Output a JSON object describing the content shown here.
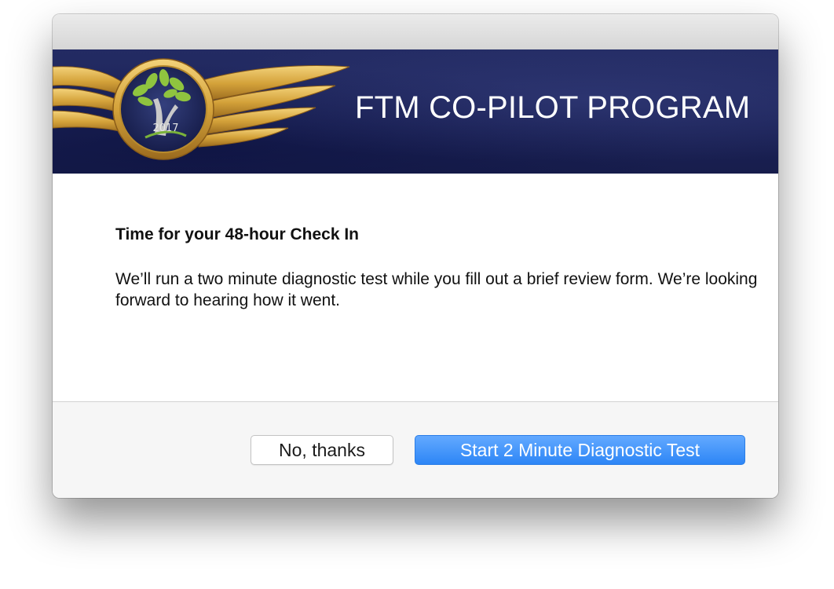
{
  "window": {
    "banner_title": "FTM CO-PILOT PROGRAM",
    "badge_year": "2017"
  },
  "dialog": {
    "heading": "Time for your 48-hour Check In",
    "body": "We’ll run a two minute diagnostic test while you fill out a brief review form. We’re looking forward to hearing how it went."
  },
  "buttons": {
    "decline_label": "No, thanks",
    "start_label": "Start 2 Minute Diagnostic Test"
  },
  "colors": {
    "banner_navy": "#1c2358",
    "primary_blue": "#3a8ff7",
    "wings_gold": "#d4a23a"
  },
  "icons": {
    "logo": "winged-tree-badge-icon"
  }
}
